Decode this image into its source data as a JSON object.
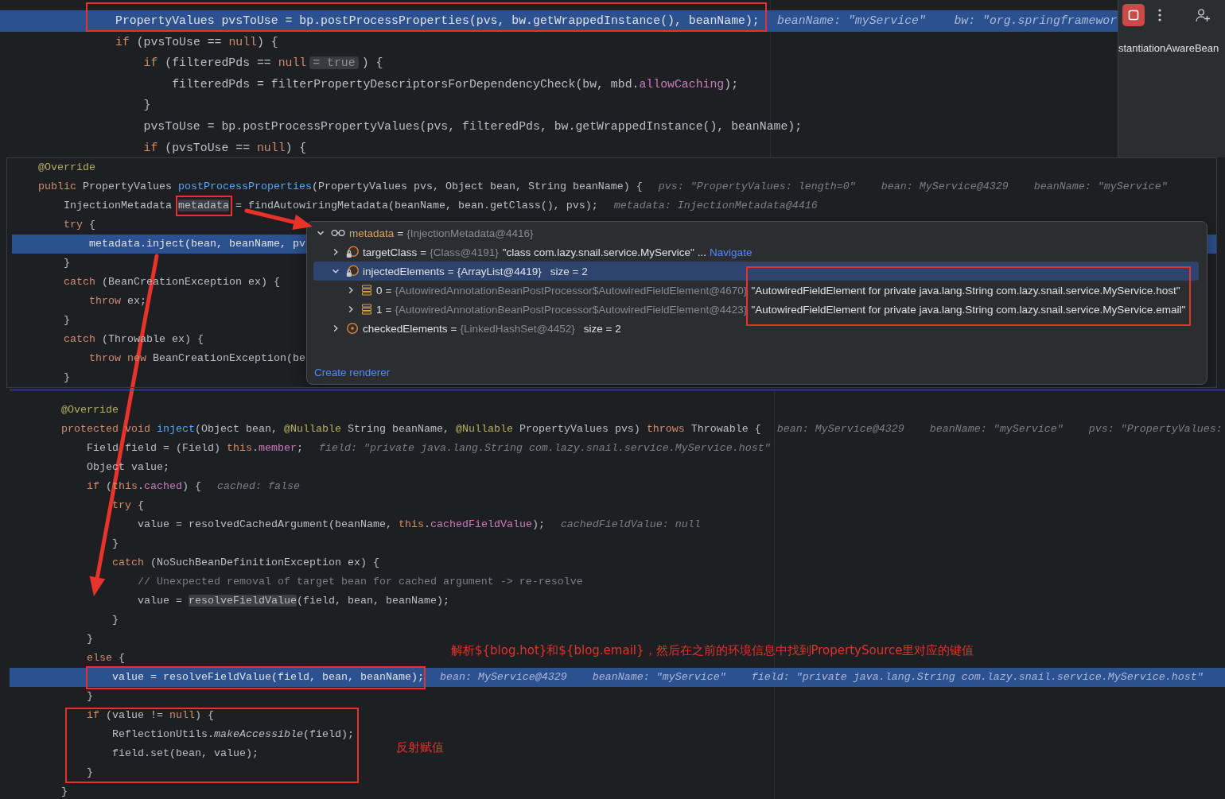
{
  "editor_top": {
    "lines": [
      {
        "tokens": [
          {
            "text": "PropertyValues pvsToUse = bp.postProcessProperties(pvs, bw.getWrappedInstance(), beanName);",
            "kind": "plain"
          }
        ],
        "highlighted": true,
        "boxed": true,
        "hints": [
          "beanName: \"myService\"",
          "bw: \"org.springframewor"
        ]
      },
      {
        "tokens": [
          {
            "text": "if",
            "kind": "keyword"
          },
          {
            "text": " (pvsToUse == ",
            "kind": "plain"
          },
          {
            "text": "null",
            "kind": "keyword"
          },
          {
            "text": ") {",
            "kind": "plain"
          }
        ],
        "highlighted": false,
        "children": [
          {
            "tokens": [
              {
                "text": "if",
                "kind": "keyword"
              },
              {
                "text": " (filteredPds == ",
                "kind": "plain"
              },
              {
                "text": "null",
                "kind": "keyword"
              }
            ],
            "inline_value": "= true",
            "tokens_after": [
              {
                "text": ") {",
                "kind": "plain"
              }
            ],
            "highlighted": false,
            "children": [
              {
                "tokens": [
                  {
                    "text": "filteredPds = filterPropertyDescriptorsForDependencyCheck(bw, mbd.",
                    "kind": "plain"
                  },
                  {
                    "text": "allowCaching",
                    "kind": "field"
                  },
                  {
                    "text": ");",
                    "kind": "plain"
                  }
                ],
                "highlighted": false
              }
            ],
            "closing": {
              "tokens": [
                {
                  "text": "}",
                  "kind": "plain"
                }
              ],
              "highlighted": false
            }
          },
          {
            "tokens": [
              {
                "text": "pvsToUse = bp.postProcessPropertyValues(pvs, filteredPds, bw.getWrappedInstance(), beanName);",
                "kind": "plain"
              }
            ],
            "highlighted": false
          },
          {
            "tokens": [
              {
                "text": "if",
                "kind": "keyword"
              },
              {
                "text": " (pvsToUse == ",
                "kind": "plain"
              },
              {
                "text": "null",
                "kind": "keyword"
              },
              {
                "text": ") {",
                "kind": "plain"
              }
            ],
            "highlighted": false
          }
        ]
      }
    ]
  },
  "side_panel": {
    "frames": [
      {
        "label": "stantiationAwareBean",
        "selected": false
      }
    ]
  },
  "editor_middle": {
    "lines": [
      {
        "tokens": [
          {
            "text": "@Override",
            "kind": "annotation"
          }
        ],
        "highlighted": false
      },
      {
        "tokens": [
          {
            "text": "public",
            "kind": "keyword"
          },
          {
            "text": " PropertyValues ",
            "kind": "plain"
          },
          {
            "text": "postProcessProperties",
            "kind": "method"
          },
          {
            "text": "(PropertyValues pvs, Object bean, String beanName) {",
            "kind": "plain"
          }
        ],
        "highlighted": false,
        "hints": [
          "pvs: \"PropertyValues: length=0\"",
          "bean: MyService@4329",
          "beanName: \"myService\""
        ],
        "children": [
          {
            "tokens": [
              {
                "text": "InjectionMetadata ",
                "kind": "plain"
              },
              {
                "text": "metadata",
                "kind": "usage",
                "boxed": true
              },
              {
                "text": " = findAutowiringMetadata(beanName, bean.getClass(), pvs);",
                "kind": "plain"
              }
            ],
            "highlighted": false,
            "hints": [
              "metadata: InjectionMetadata@4416"
            ]
          },
          {
            "tokens": [
              {
                "text": "try",
                "kind": "keyword"
              },
              {
                "text": " {",
                "kind": "plain"
              }
            ],
            "highlighted": false,
            "children": [
              {
                "tokens": [
                  {
                    "text": "metadata.inject(bean, beanName, pv",
                    "kind": "plain"
                  }
                ],
                "highlighted": true
              }
            ],
            "closing": {
              "tokens": [
                {
                  "text": "}",
                  "kind": "plain"
                }
              ],
              "highlighted": false
            }
          },
          {
            "tokens": [
              {
                "text": "catch",
                "kind": "keyword"
              },
              {
                "text": " (BeanCreationException ex) {",
                "kind": "plain"
              }
            ],
            "highlighted": false,
            "children": [
              {
                "tokens": [
                  {
                    "text": "throw",
                    "kind": "keyword"
                  },
                  {
                    "text": " ex;",
                    "kind": "plain"
                  }
                ],
                "highlighted": false
              }
            ],
            "closing": {
              "tokens": [
                {
                  "text": "}",
                  "kind": "plain"
                }
              ],
              "highlighted": false
            }
          },
          {
            "tokens": [
              {
                "text": "catch",
                "kind": "keyword"
              },
              {
                "text": " (Throwable ex) {",
                "kind": "plain"
              }
            ],
            "highlighted": false,
            "children": [
              {
                "tokens": [
                  {
                    "text": "throw",
                    "kind": "keyword"
                  },
                  {
                    "text": " new",
                    "kind": "keyword"
                  },
                  {
                    "text": " BeanCreationException(be",
                    "kind": "plain"
                  }
                ],
                "highlighted": false
              }
            ],
            "closing": {
              "tokens": [
                {
                  "text": "}",
                  "kind": "plain"
                }
              ],
              "highlighted": false
            }
          }
        ]
      }
    ],
    "debug_popup": {
      "tree": [
        {
          "name": "metadata",
          "separator": "=",
          "type": "{InjectionMetadata@4416}",
          "kind": "watch",
          "expanded": true,
          "selected": false,
          "children": [
            {
              "name": "targetClass",
              "separator": "=",
              "type": "{Class@4191}",
              "value": "\"class com.lazy.snail.service.MyService\"",
              "suffix": "...",
              "link": "Navigate",
              "kind": "private_field",
              "expanded": false,
              "selected": false
            },
            {
              "name": "injectedElements",
              "separator": "=",
              "type": "{ArrayList@4419}",
              "size": "size = 2",
              "kind": "private_field",
              "expanded": true,
              "selected": true,
              "children": [
                {
                  "name": "0",
                  "separator": "=",
                  "type": "{AutowiredAnnotationBeanPostProcessor$AutowiredFieldElement@4670}",
                  "value": "\"AutowiredFieldElement for private java.lang.String com.lazy.snail.service.MyService.host\"",
                  "kind": "element",
                  "expanded": false,
                  "selected": false,
                  "value_boxed": true
                },
                {
                  "name": "1",
                  "separator": "=",
                  "type": "{AutowiredAnnotationBeanPostProcessor$AutowiredFieldElement@4423}",
                  "value": "\"AutowiredFieldElement for private java.lang.String com.lazy.snail.service.MyService.email\"",
                  "kind": "element",
                  "expanded": false,
                  "selected": false,
                  "value_boxed": true
                }
              ]
            },
            {
              "name": "checkedElements",
              "separator": "=",
              "type": "{LinkedHashSet@4452}",
              "size": "size = 2",
              "kind": "field",
              "expanded": false,
              "selected": false
            }
          ]
        }
      ],
      "footer_link": "Create renderer"
    }
  },
  "editor_bottom": {
    "lines": [
      {
        "tokens": [
          {
            "text": "@Override",
            "kind": "annotation"
          }
        ],
        "highlighted": false
      },
      {
        "tokens": [
          {
            "text": "protected",
            "kind": "keyword"
          },
          {
            "text": " void",
            "kind": "keyword"
          },
          {
            "text": " inject",
            "kind": "method"
          },
          {
            "text": "(Object bean, ",
            "kind": "plain"
          },
          {
            "text": "@Nullable",
            "kind": "annotation"
          },
          {
            "text": " String beanName, ",
            "kind": "plain"
          },
          {
            "text": "@Nullable",
            "kind": "annotation"
          },
          {
            "text": " PropertyValues pvs) ",
            "kind": "plain"
          },
          {
            "text": "throws",
            "kind": "keyword"
          },
          {
            "text": " Throwable {",
            "kind": "plain"
          }
        ],
        "highlighted": false,
        "hints": [
          "bean: MyService@4329",
          "beanName: \"myService\"",
          "pvs: \"PropertyValues:"
        ],
        "children": [
          {
            "tokens": [
              {
                "text": "Field field = (Field) ",
                "kind": "plain"
              },
              {
                "text": "this",
                "kind": "keyword"
              },
              {
                "text": ".",
                "kind": "plain"
              },
              {
                "text": "member",
                "kind": "field"
              },
              {
                "text": ";",
                "kind": "plain"
              }
            ],
            "highlighted": false,
            "hints": [
              "field: \"private java.lang.String com.lazy.snail.service.MyService.host\""
            ]
          },
          {
            "tokens": [
              {
                "text": "Object value;",
                "kind": "plain"
              }
            ],
            "highlighted": false
          },
          {
            "tokens": [
              {
                "text": "if",
                "kind": "keyword"
              },
              {
                "text": " (",
                "kind": "plain"
              },
              {
                "text": "this",
                "kind": "keyword"
              },
              {
                "text": ".",
                "kind": "plain"
              },
              {
                "text": "cached",
                "kind": "field"
              },
              {
                "text": ") {",
                "kind": "plain"
              }
            ],
            "highlighted": false,
            "hints": [
              "cached: false"
            ],
            "children": [
              {
                "tokens": [
                  {
                    "text": "try",
                    "kind": "keyword"
                  },
                  {
                    "text": " {",
                    "kind": "plain"
                  }
                ],
                "highlighted": false,
                "children": [
                  {
                    "tokens": [
                      {
                        "text": "value = resolvedCachedArgument(beanName, ",
                        "kind": "plain"
                      },
                      {
                        "text": "this",
                        "kind": "keyword"
                      },
                      {
                        "text": ".",
                        "kind": "plain"
                      },
                      {
                        "text": "cachedFieldValue",
                        "kind": "field"
                      },
                      {
                        "text": ");",
                        "kind": "plain"
                      }
                    ],
                    "highlighted": false,
                    "hints": [
                      "cachedFieldValue: null"
                    ]
                  }
                ],
                "closing": {
                  "tokens": [
                    {
                      "text": "}",
                      "kind": "plain"
                    }
                  ],
                  "highlighted": false
                }
              },
              {
                "tokens": [
                  {
                    "text": "catch",
                    "kind": "keyword"
                  },
                  {
                    "text": " (NoSuchBeanDefinitionException ex) {",
                    "kind": "plain"
                  }
                ],
                "highlighted": false,
                "children": [
                  {
                    "tokens": [
                      {
                        "text": "// Unexpected removal of target bean for cached argument -> re-resolve",
                        "kind": "comment"
                      }
                    ],
                    "highlighted": false
                  },
                  {
                    "tokens": [
                      {
                        "text": "value = ",
                        "kind": "plain"
                      },
                      {
                        "text": "resolveFieldValue",
                        "kind": "usage"
                      },
                      {
                        "text": "(field, bean, beanName);",
                        "kind": "plain"
                      }
                    ],
                    "highlighted": false
                  }
                ],
                "closing": {
                  "tokens": [
                    {
                      "text": "}",
                      "kind": "plain"
                    }
                  ],
                  "highlighted": false
                }
              }
            ],
            "closing": {
              "tokens": [
                {
                  "text": "}",
                  "kind": "plain"
                }
              ],
              "highlighted": false
            }
          },
          {
            "tokens": [
              {
                "text": "else",
                "kind": "keyword"
              },
              {
                "text": " {",
                "kind": "plain"
              }
            ],
            "highlighted": false,
            "note": "解析${blog.hot}和${blog.email}，然后在之前的环境信息中找到PropertySource里对应的键值",
            "children": [
              {
                "tokens": [
                  {
                    "text": "value = resolveFieldValue(field, bean, beanName);",
                    "kind": "plain"
                  }
                ],
                "highlighted": true,
                "boxed": true,
                "hints": [
                  "bean: MyService@4329",
                  "beanName: \"myService\"",
                  "field: \"private java.lang.String com.lazy.snail.service.MyService.host\""
                ]
              }
            ],
            "closing": {
              "tokens": [
                {
                  "text": "}",
                  "kind": "plain"
                }
              ],
              "highlighted": false
            }
          },
          {
            "tokens": [
              {
                "text": "if",
                "kind": "keyword"
              },
              {
                "text": " (value != ",
                "kind": "plain"
              },
              {
                "text": "null",
                "kind": "keyword"
              },
              {
                "text": ") {",
                "kind": "plain"
              }
            ],
            "highlighted": false,
            "boxed": true,
            "children": [
              {
                "tokens": [
                  {
                    "text": "ReflectionUtils.",
                    "kind": "plain"
                  },
                  {
                    "text": "makeAccessible",
                    "kind": "static"
                  },
                  {
                    "text": "(field);",
                    "kind": "plain"
                  }
                ],
                "highlighted": false,
                "note": "反射赋值"
              },
              {
                "tokens": [
                  {
                    "text": "field.set(bean, value);",
                    "kind": "plain"
                  }
                ],
                "highlighted": false
              }
            ],
            "closing": {
              "tokens": [
                {
                  "text": "}",
                  "kind": "plain"
                }
              ],
              "highlighted": false
            }
          }
        ],
        "closing": {
          "tokens": [
            {
              "text": "}",
              "kind": "plain"
            }
          ],
          "highlighted": false
        }
      }
    ]
  }
}
